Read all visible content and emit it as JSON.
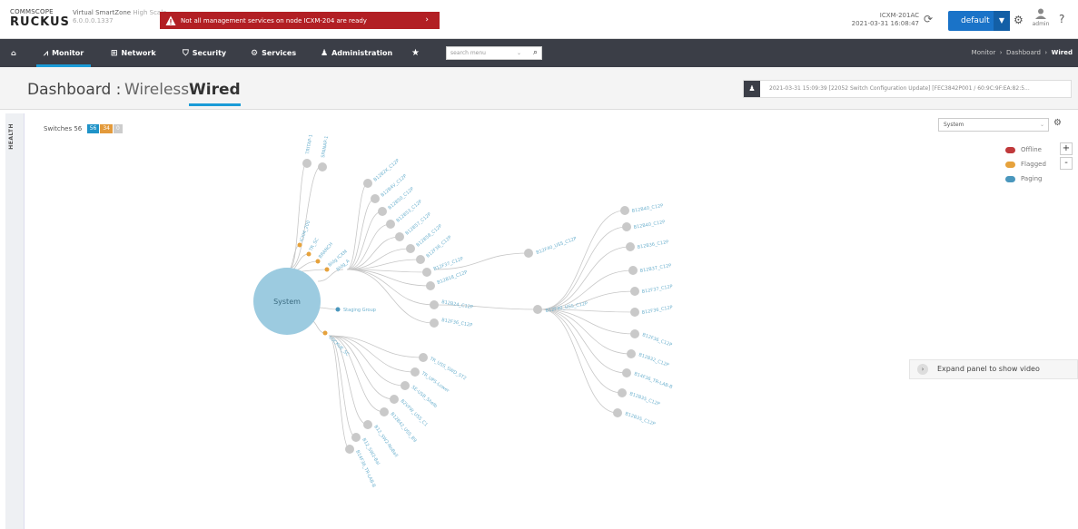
{
  "header": {
    "logo_line1": "COMMSCOPE",
    "logo_line2": "RUCKUS",
    "product_name": "Virtual SmartZone",
    "product_edition": "High Scale",
    "version": "6.0.0.0.1337",
    "alert_text": "Not all management services on node ICXM-204 are ready",
    "controller_name": "ICXM-201AC",
    "controller_time": "2021-03-31  16:08:47",
    "zone_button": "default",
    "user_name": "admin",
    "icons": [
      "refresh-icon",
      "gear-icon",
      "user-icon",
      "help-icon",
      "warning-icon"
    ]
  },
  "nav": {
    "items": [
      {
        "label": "Monitor",
        "icon": "chart-icon"
      },
      {
        "label": "Network",
        "icon": "network-icon"
      },
      {
        "label": "Security",
        "icon": "shield-icon"
      },
      {
        "label": "Services",
        "icon": "cogs-icon"
      },
      {
        "label": "Administration",
        "icon": "user-icon"
      }
    ],
    "search_placeholder": "search menu",
    "breadcrumb": [
      "Monitor",
      "Dashboard",
      "Wired"
    ]
  },
  "dashboard": {
    "label": "Dashboard :",
    "tabs": [
      "Wireless",
      "Wired"
    ],
    "active_tab": "Wired",
    "event_text": "2021-03-31 15:09:39 [22052 Switch Configuration Update] [FEC3842P001 / 60:9C:9F:EA:82:5..."
  },
  "health": {
    "label": "HEALTH",
    "switches_label": "Switches",
    "switches_total": "56",
    "badges": [
      {
        "value": "56",
        "color": "#1f93c8"
      },
      {
        "value": "34",
        "color": "#e39a3b"
      },
      {
        "value": "0",
        "color": "#cccccc"
      }
    ]
  },
  "topology": {
    "selector_value": "System",
    "legend": [
      {
        "label": "Offline",
        "color": "#c0393b"
      },
      {
        "label": "Flagged",
        "color": "#e6a23c"
      },
      {
        "label": "Paging",
        "color": "#4a97bd"
      }
    ],
    "root_label": "System",
    "paging_group": "Staging Group",
    "expand_panel": "Expand panel to show video",
    "group_labels": [
      "TRITAP-1",
      "SPANAP-1",
      "ICXM_200",
      "TR_SC",
      "BRANCH",
      "Bldg ICXM",
      "Bldg_A",
      "LOCKUE_SC"
    ],
    "branch1_nodes": [
      "B12B2K_C12P",
      "B12B4V_C12P",
      "B12B50_C12P",
      "B12B53_C12P",
      "B12B57_C12P",
      "B12B58_C12P",
      "B12F36_C12P",
      "B12F37_C12P",
      "B12B18_C12P",
      "B12B24_C12P",
      "B12F36_C12P"
    ],
    "branch2_mid": "B12F40_USS_C12P",
    "branch3_mid": "B12F40_USS_C12P",
    "right_nodes": [
      "B12B40_C12P",
      "B12B40_C12P",
      "B12B36_C12P",
      "B12B37_C12P",
      "B12F37_C12P",
      "B12F36_C12P",
      "B12F36_C12P",
      "B12B32_C12P",
      "B14F36_TR-LAB-B",
      "B12B35_C12P",
      "B12B35_C12P"
    ],
    "lower_nodes": [
      "TR_USS_SWD_ST2",
      "TR_UPS-Lower",
      "SE-USB_Shelb",
      "B2VFW_USS_C1",
      "B12B42_USS_B9",
      "B12_SW2-NoBall",
      "B12_SW2-Bal",
      "B14F36_TR-LAB-B"
    ]
  }
}
